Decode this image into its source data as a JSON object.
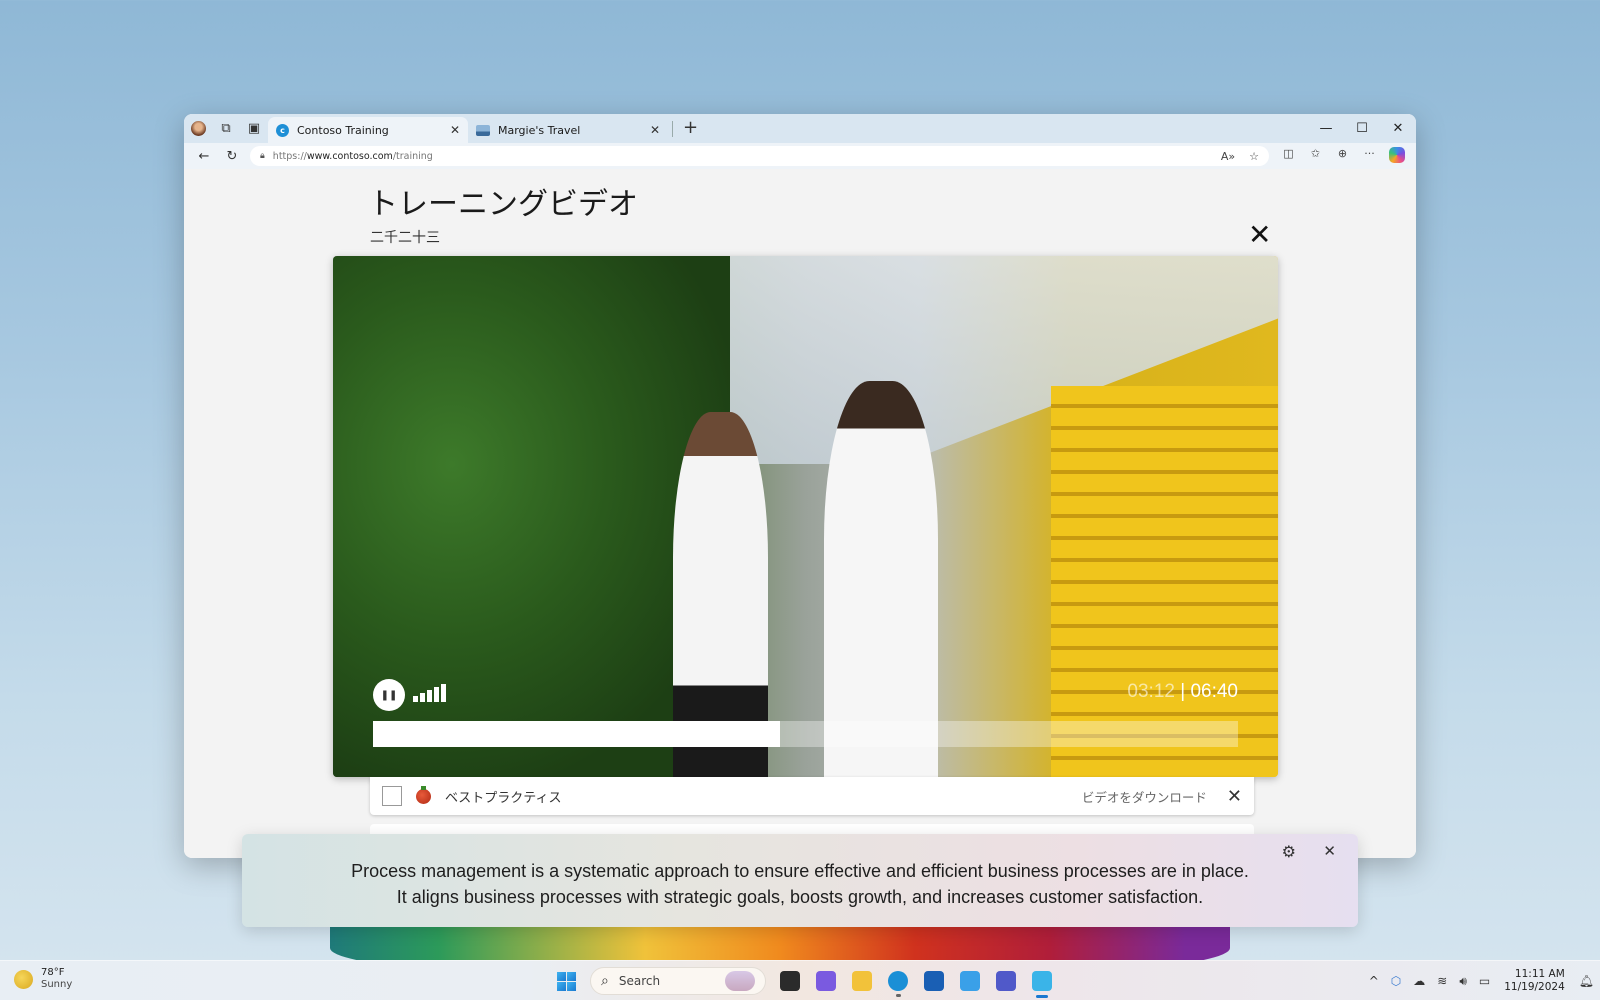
{
  "browser": {
    "tabs": [
      {
        "label": "Contoso Training",
        "active": true,
        "favicon": "contoso-c-icon"
      },
      {
        "label": "Margie's Travel",
        "active": false,
        "favicon": "travel-icon"
      }
    ],
    "new_tab_symbol": "+",
    "url": {
      "scheme": "https://",
      "host": "www.contoso.com",
      "path": "/training"
    },
    "window_controls": {
      "minimize": "—",
      "maximize": "☐",
      "close": "✕"
    },
    "nav": {
      "back": "←",
      "refresh": "↻"
    }
  },
  "page": {
    "title": "トレーニングビデオ",
    "subtitle": "二千二十三",
    "close_symbol": "✕"
  },
  "video": {
    "current_time": "03:12",
    "separator": "|",
    "duration": "06:40",
    "progress_fraction": 0.47,
    "volume_level": 5,
    "volume_max": 5,
    "state": "playing",
    "pause_symbol": "❚❚"
  },
  "list": {
    "items": [
      {
        "label": "ベストプラクティス",
        "action": "ビデオをダウンロード",
        "checked": false,
        "icon": "tomato-icon"
      }
    ]
  },
  "captions": {
    "lines": [
      "Process management is a systematic approach to ensure effective and efficient business processes are in place.",
      "It aligns business processes with strategic goals, boosts growth, and increases customer satisfaction."
    ],
    "settings_symbol": "⚙",
    "close_symbol": "✕"
  },
  "taskbar": {
    "weather": {
      "temp": "78°F",
      "condition": "Sunny"
    },
    "search_placeholder": "Search",
    "apps": [
      {
        "name": "task-view",
        "color": "#2b2b2b"
      },
      {
        "name": "copilot",
        "color": "#7a5ae0"
      },
      {
        "name": "file-explorer",
        "color": "#f2c23a"
      },
      {
        "name": "edge",
        "color": "#1a8fd6"
      },
      {
        "name": "microsoft-store",
        "color": "#1a5fb4"
      },
      {
        "name": "app-plus",
        "color": "#3aa0e8"
      },
      {
        "name": "teams",
        "color": "#5059c9"
      },
      {
        "name": "active-app",
        "color": "#3ab4e8"
      }
    ],
    "tray": {
      "chevron": "^",
      "time": "11:11 AM",
      "date": "11/19/2024"
    }
  }
}
